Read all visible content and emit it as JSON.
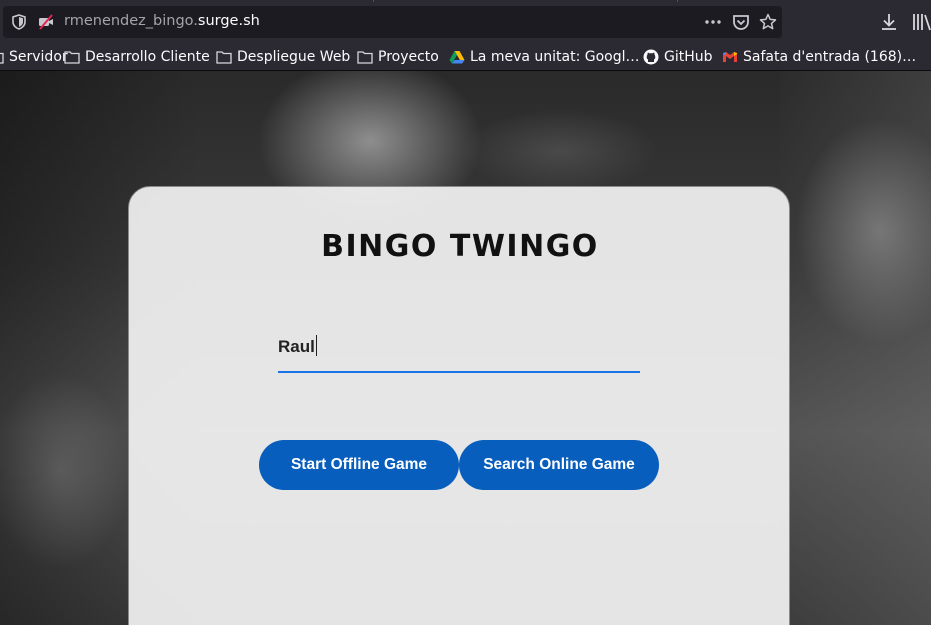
{
  "browser": {
    "url_path": "rmenendez_bingo.",
    "url_host": "surge.sh",
    "bookmarks": [
      {
        "label": "Servidor",
        "icon": "folder-icon"
      },
      {
        "label": "Desarrollo Cliente",
        "icon": "folder-icon"
      },
      {
        "label": "Despliegue Web",
        "icon": "folder-icon"
      },
      {
        "label": "Proyecto",
        "icon": "folder-icon"
      },
      {
        "label": "La meva unitat: Googl…",
        "icon": "google-drive-icon"
      },
      {
        "label": "GitHub",
        "icon": "github-icon"
      },
      {
        "label": "Safata d'entrada (168)…",
        "icon": "gmail-icon"
      }
    ]
  },
  "page": {
    "title": "BINGO TWINGO",
    "name_input": {
      "value": "Raul"
    },
    "buttons": {
      "offline": "Start Offline Game",
      "online": "Search Online Game"
    }
  },
  "colors": {
    "accent": "#075ebd",
    "input_underline": "#1a73e8",
    "chrome_bg": "#2b2a33",
    "urlbar_bg": "#1c1b22"
  }
}
